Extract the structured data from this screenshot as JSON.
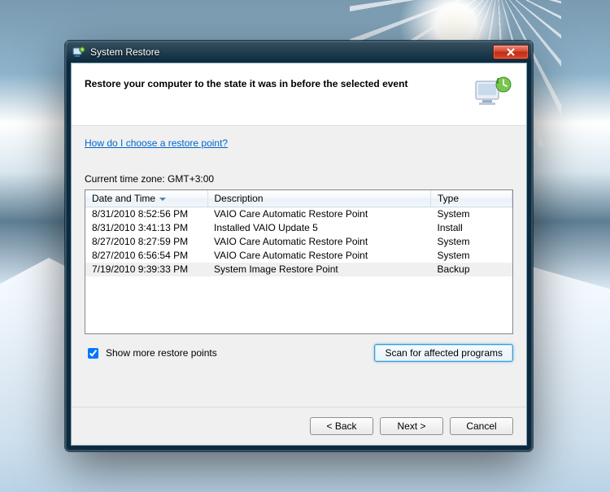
{
  "window": {
    "title": "System Restore"
  },
  "header": {
    "instruction": "Restore your computer to the state it was in before the selected event"
  },
  "help_link": "How do I choose a restore point?",
  "timezone_text": "Current time zone: GMT+3:00",
  "columns": {
    "datetime": "Date and Time",
    "description": "Description",
    "type": "Type"
  },
  "rows": [
    {
      "datetime": "8/31/2010 8:52:56 PM",
      "description": "VAIO Care Automatic Restore Point",
      "type": "System",
      "selected": false
    },
    {
      "datetime": "8/31/2010 3:41:13 PM",
      "description": "Installed VAIO Update 5",
      "type": "Install",
      "selected": false
    },
    {
      "datetime": "8/27/2010 8:27:59 PM",
      "description": "VAIO Care Automatic Restore Point",
      "type": "System",
      "selected": false
    },
    {
      "datetime": "8/27/2010 6:56:54 PM",
      "description": "VAIO Care Automatic Restore Point",
      "type": "System",
      "selected": false
    },
    {
      "datetime": "7/19/2010 9:39:33 PM",
      "description": "System Image Restore Point",
      "type": "Backup",
      "selected": true
    }
  ],
  "show_more": {
    "label": "Show more restore points",
    "checked": true
  },
  "scan_button": "Scan for affected programs",
  "footer": {
    "back": "< Back",
    "next": "Next >",
    "cancel": "Cancel"
  }
}
